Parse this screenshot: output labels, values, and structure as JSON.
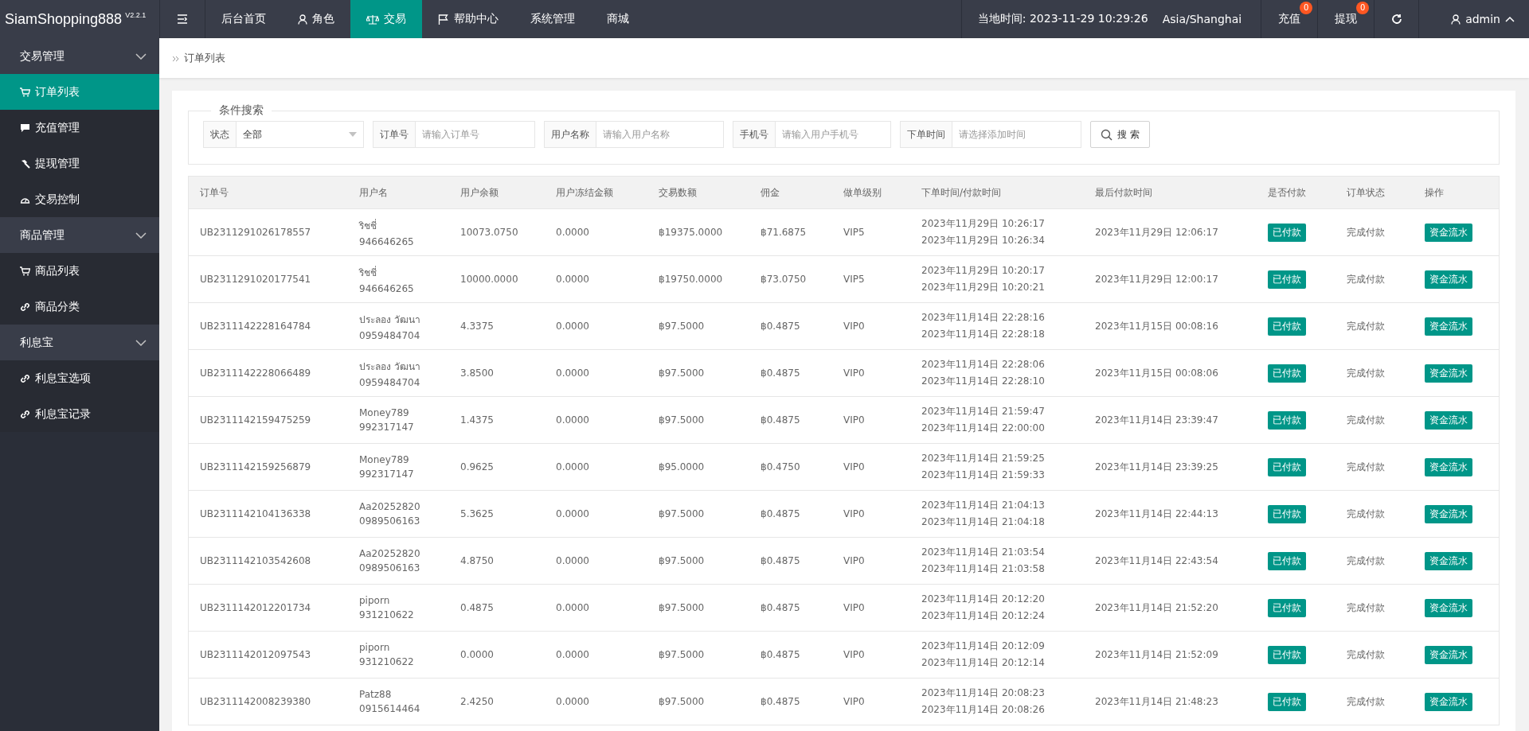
{
  "brand": {
    "name": "SiamShopping888",
    "version": "V2.2.1"
  },
  "nav": [
    {
      "label": "后台首页",
      "selected": false
    },
    {
      "label": "角色",
      "selected": false
    },
    {
      "label": "交易",
      "selected": true
    },
    {
      "label": "帮助中心",
      "selected": false
    },
    {
      "label": "系统管理",
      "selected": false
    },
    {
      "label": "商城",
      "selected": false
    }
  ],
  "header_right": {
    "clock": "当地时间: 2023-11-29 10:29:26",
    "timezone": "Asia/Shanghai",
    "actions": [
      {
        "label": "充值",
        "badge": "0"
      },
      {
        "label": "提现",
        "badge": "0"
      }
    ],
    "user": "admin"
  },
  "sidebar": [
    {
      "label": "交易管理",
      "expanded": true,
      "children": [
        {
          "label": "订单列表",
          "selected": true
        },
        {
          "label": "充值管理",
          "selected": false
        },
        {
          "label": "提现管理",
          "selected": false
        },
        {
          "label": "交易控制",
          "selected": false
        }
      ]
    },
    {
      "label": "商品管理",
      "expanded": true,
      "children": [
        {
          "label": "商品列表",
          "selected": false
        },
        {
          "label": "商品分类",
          "selected": false
        }
      ]
    },
    {
      "label": "利息宝",
      "expanded": true,
      "children": [
        {
          "label": "利息宝选项",
          "selected": false
        },
        {
          "label": "利息宝记录",
          "selected": false
        }
      ]
    }
  ],
  "breadcrumb": "订单列表",
  "search": {
    "legend": "条件搜索",
    "fields": [
      {
        "kind": "select",
        "label": "状态",
        "value": "全部"
      },
      {
        "kind": "text",
        "label": "订单号",
        "placeholder": "请输入订单号"
      },
      {
        "kind": "text",
        "label": "用户名称",
        "placeholder": "请输入用户名称"
      },
      {
        "kind": "text",
        "label": "手机号",
        "placeholder": "请输入用户手机号"
      },
      {
        "kind": "text",
        "label": "下单时间",
        "placeholder": "请选择添加时间"
      }
    ],
    "button": "搜 索"
  },
  "table": {
    "columns": [
      "订单号",
      "用户名",
      "用户余额",
      "用户冻结金额",
      "交易数额",
      "佣金",
      "做单级别",
      "下单时间/付款时间",
      "最后付款时间",
      "是否付款",
      "订单状态",
      "操作"
    ],
    "rows": [
      {
        "order": "UB2311291026178557",
        "user": "ริชชี่",
        "phone": "946646265",
        "balance": "10073.0750",
        "frozen": "0.0000",
        "amount": "฿19375.0000",
        "commission": "฿71.6875",
        "level": "VIP5",
        "order_time": "2023年11月29日 10:26:17",
        "pay_time": "2023年11月29日 10:26:34",
        "last_pay": "2023年11月29日 12:06:17",
        "paid": "已付款",
        "status": "完成付款",
        "action": "资金流水"
      },
      {
        "order": "UB2311291020177541",
        "user": "ริชชี่",
        "phone": "946646265",
        "balance": "10000.0000",
        "frozen": "0.0000",
        "amount": "฿19750.0000",
        "commission": "฿73.0750",
        "level": "VIP5",
        "order_time": "2023年11月29日 10:20:17",
        "pay_time": "2023年11月29日 10:20:21",
        "last_pay": "2023年11月29日 12:00:17",
        "paid": "已付款",
        "status": "完成付款",
        "action": "资金流水"
      },
      {
        "order": "UB2311142228164784",
        "user": "ประลอง วัฒนา",
        "phone": "0959484704",
        "balance": "4.3375",
        "frozen": "0.0000",
        "amount": "฿97.5000",
        "commission": "฿0.4875",
        "level": "VIP0",
        "order_time": "2023年11月14日 22:28:16",
        "pay_time": "2023年11月14日 22:28:18",
        "last_pay": "2023年11月15日 00:08:16",
        "paid": "已付款",
        "status": "完成付款",
        "action": "资金流水"
      },
      {
        "order": "UB2311142228066489",
        "user": "ประลอง วัฒนา",
        "phone": "0959484704",
        "balance": "3.8500",
        "frozen": "0.0000",
        "amount": "฿97.5000",
        "commission": "฿0.4875",
        "level": "VIP0",
        "order_time": "2023年11月14日 22:28:06",
        "pay_time": "2023年11月14日 22:28:10",
        "last_pay": "2023年11月15日 00:08:06",
        "paid": "已付款",
        "status": "完成付款",
        "action": "资金流水"
      },
      {
        "order": "UB2311142159475259",
        "user": "Money789",
        "phone": "992317147",
        "balance": "1.4375",
        "frozen": "0.0000",
        "amount": "฿97.5000",
        "commission": "฿0.4875",
        "level": "VIP0",
        "order_time": "2023年11月14日 21:59:47",
        "pay_time": "2023年11月14日 22:00:00",
        "last_pay": "2023年11月14日 23:39:47",
        "paid": "已付款",
        "status": "完成付款",
        "action": "资金流水"
      },
      {
        "order": "UB2311142159256879",
        "user": "Money789",
        "phone": "992317147",
        "balance": "0.9625",
        "frozen": "0.0000",
        "amount": "฿95.0000",
        "commission": "฿0.4750",
        "level": "VIP0",
        "order_time": "2023年11月14日 21:59:25",
        "pay_time": "2023年11月14日 21:59:33",
        "last_pay": "2023年11月14日 23:39:25",
        "paid": "已付款",
        "status": "完成付款",
        "action": "资金流水"
      },
      {
        "order": "UB2311142104136338",
        "user": "Aa20252820",
        "phone": "0989506163",
        "balance": "5.3625",
        "frozen": "0.0000",
        "amount": "฿97.5000",
        "commission": "฿0.4875",
        "level": "VIP0",
        "order_time": "2023年11月14日 21:04:13",
        "pay_time": "2023年11月14日 21:04:18",
        "last_pay": "2023年11月14日 22:44:13",
        "paid": "已付款",
        "status": "完成付款",
        "action": "资金流水"
      },
      {
        "order": "UB2311142103542608",
        "user": "Aa20252820",
        "phone": "0989506163",
        "balance": "4.8750",
        "frozen": "0.0000",
        "amount": "฿97.5000",
        "commission": "฿0.4875",
        "level": "VIP0",
        "order_time": "2023年11月14日 21:03:54",
        "pay_time": "2023年11月14日 21:03:58",
        "last_pay": "2023年11月14日 22:43:54",
        "paid": "已付款",
        "status": "完成付款",
        "action": "资金流水"
      },
      {
        "order": "UB2311142012201734",
        "user": "piporn",
        "phone": "931210622",
        "balance": "0.4875",
        "frozen": "0.0000",
        "amount": "฿97.5000",
        "commission": "฿0.4875",
        "level": "VIP0",
        "order_time": "2023年11月14日 20:12:20",
        "pay_time": "2023年11月14日 20:12:24",
        "last_pay": "2023年11月14日 21:52:20",
        "paid": "已付款",
        "status": "完成付款",
        "action": "资金流水"
      },
      {
        "order": "UB2311142012097543",
        "user": "piporn",
        "phone": "931210622",
        "balance": "0.0000",
        "frozen": "0.0000",
        "amount": "฿97.5000",
        "commission": "฿0.4875",
        "level": "VIP0",
        "order_time": "2023年11月14日 20:12:09",
        "pay_time": "2023年11月14日 20:12:14",
        "last_pay": "2023年11月14日 21:52:09",
        "paid": "已付款",
        "status": "完成付款",
        "action": "资金流水"
      },
      {
        "order": "UB2311142008239380",
        "user": "Patz88",
        "phone": "0915614464",
        "balance": "2.4250",
        "frozen": "0.0000",
        "amount": "฿97.5000",
        "commission": "฿0.4875",
        "level": "VIP0",
        "order_time": "2023年11月14日 20:08:23",
        "pay_time": "2023年11月14日 20:08:26",
        "last_pay": "2023年11月14日 21:48:23",
        "paid": "已付款",
        "status": "完成付款",
        "action": "资金流水"
      }
    ]
  }
}
